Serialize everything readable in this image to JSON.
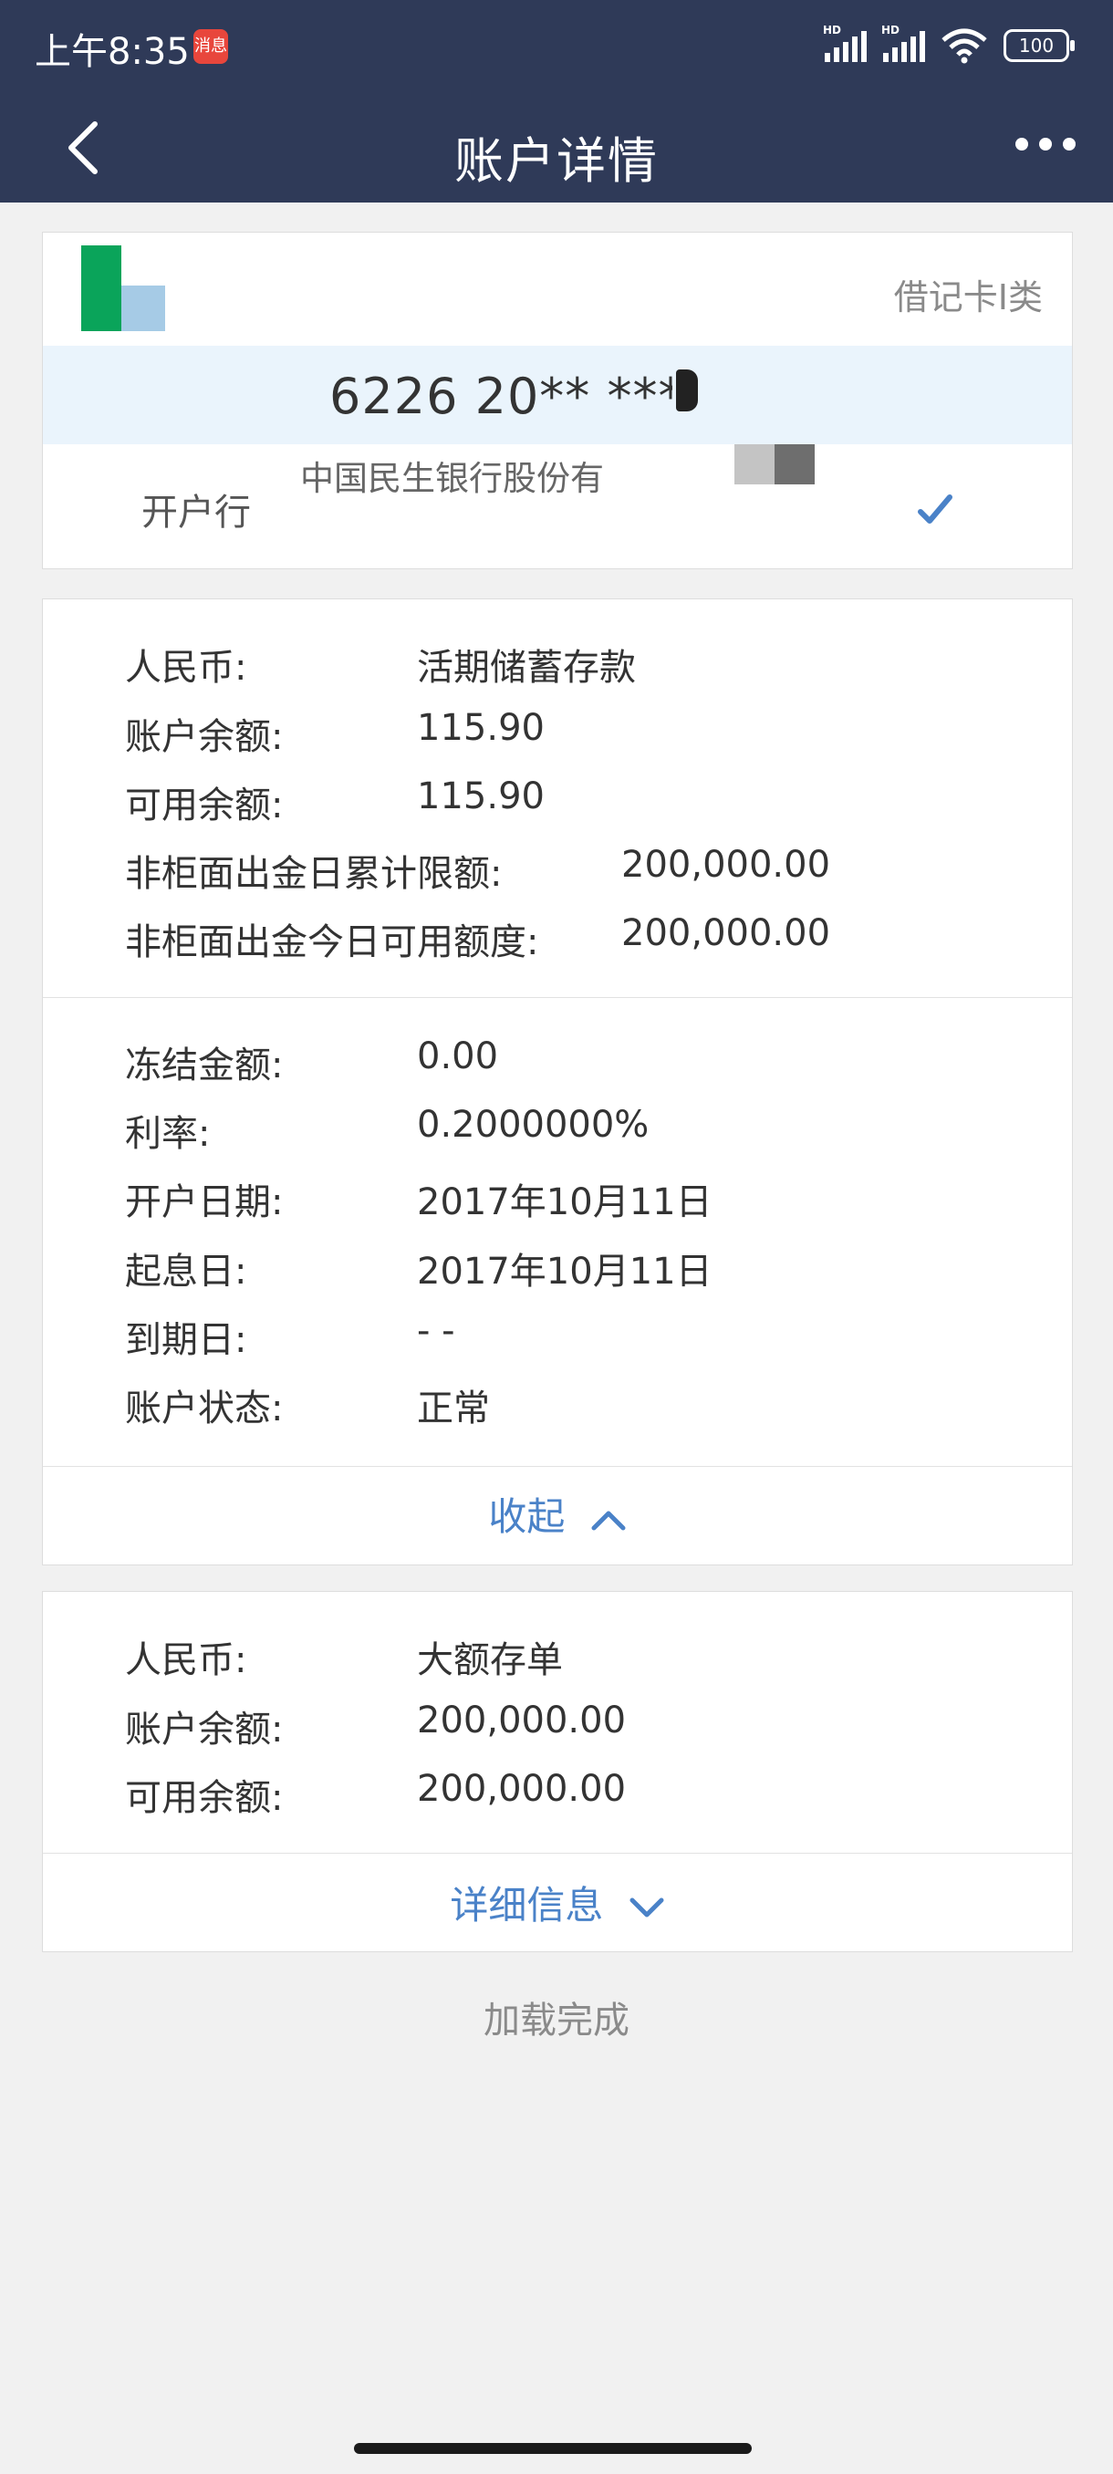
{
  "status": {
    "time": "上午8:35",
    "app_badge": "消息",
    "signal1": "HD",
    "signal2": "HD",
    "battery": "100"
  },
  "nav": {
    "title": "账户详情"
  },
  "card": {
    "type": "借记卡I类",
    "number": "6226 20** ****",
    "bank_label": "开户行",
    "bank_name": "中国民生银行股份有"
  },
  "account1": {
    "rows": [
      {
        "label": "人民币:",
        "value": "活期储蓄存款"
      },
      {
        "label": "账户余额:",
        "value": "115.90"
      },
      {
        "label": "可用余额:",
        "value": "115.90"
      },
      {
        "label": "非柜面出金日累计限额:",
        "value": "200,000.00"
      },
      {
        "label": "非柜面出金今日可用额度:",
        "value": "200,000.00"
      }
    ],
    "details": [
      {
        "label": "冻结金额:",
        "value": "0.00"
      },
      {
        "label": "利率:",
        "value": "0.2000000%"
      },
      {
        "label": "开户日期:",
        "value": "2017年10月11日"
      },
      {
        "label": "起息日:",
        "value": "2017年10月11日"
      },
      {
        "label": "到期日:",
        "value": "- -"
      },
      {
        "label": "账户状态:",
        "value": "正常"
      }
    ],
    "toggle_label": "收起"
  },
  "account2": {
    "rows": [
      {
        "label": "人民币:",
        "value": "大额存单"
      },
      {
        "label": "账户余额:",
        "value": "200,000.00"
      },
      {
        "label": "可用余额:",
        "value": "200,000.00"
      }
    ],
    "toggle_label": "详细信息"
  },
  "footer": {
    "load_status": "加载完成"
  },
  "colors": {
    "nav_bg": "#2f3a58",
    "link": "#4a82c8",
    "logo_green": "#0aa45a",
    "logo_blue": "#a6cbe6"
  },
  "icons": [
    "back-arrow-icon",
    "more-dots-icon",
    "checkmark-icon",
    "chevron-up-icon",
    "chevron-down-icon"
  ]
}
